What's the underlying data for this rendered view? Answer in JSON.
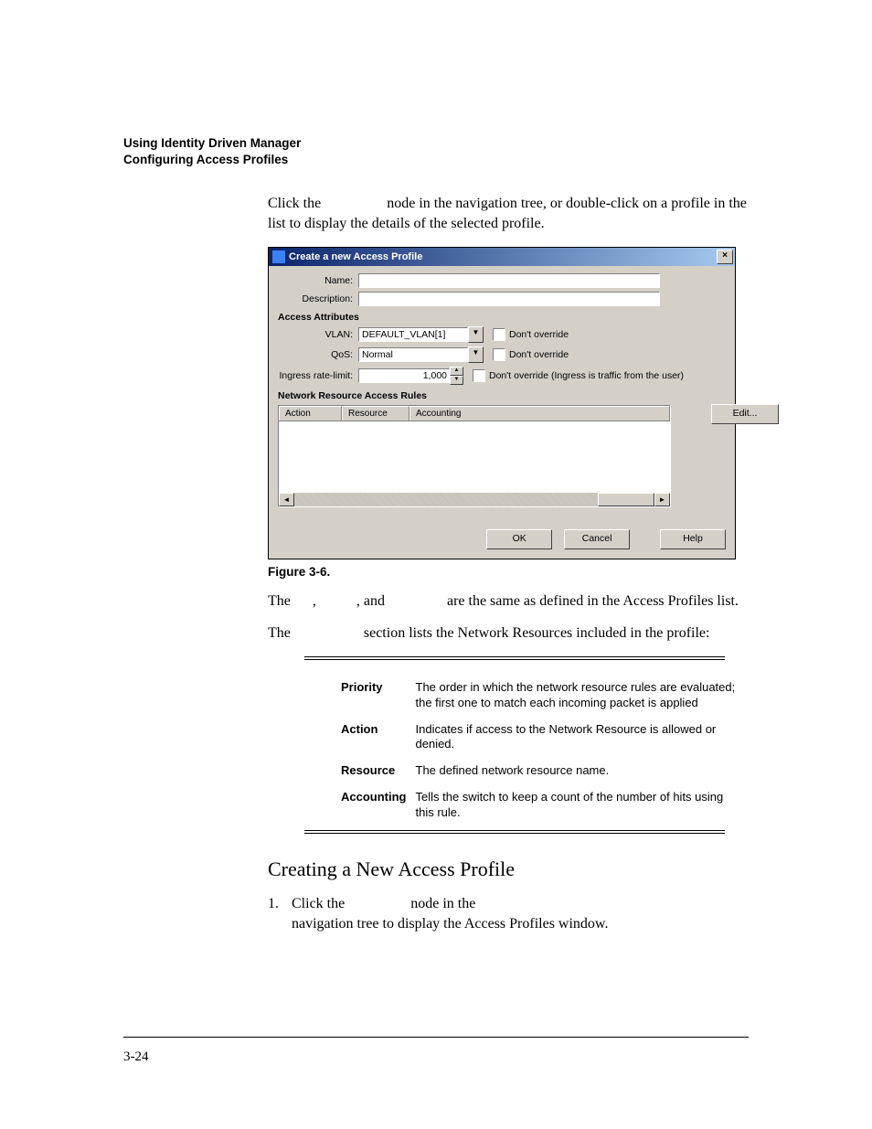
{
  "header": {
    "line1": "Using Identity Driven Manager",
    "line2": "Configuring Access Profiles"
  },
  "intro": {
    "p1": "Click the                  node in the navigation tree, or double-click on a profile in the list to display the details of the selected profile."
  },
  "dialog": {
    "title": "Create a new Access Profile",
    "name_label": "Name:",
    "name_value": "",
    "desc_label": "Description:",
    "desc_value": "",
    "group_attrs": "Access Attributes",
    "vlan_label": "VLAN:",
    "vlan_value": "DEFAULT_VLAN[1]",
    "qos_label": "QoS:",
    "qos_value": "Normal",
    "rate_label": "Ingress rate-limit:",
    "rate_value": "1,000",
    "dont_override": "Don't override",
    "rate_hint": "Don't override  (Ingress is traffic from the user)",
    "group_rules": "Network Resource Access Rules",
    "col_action": "Action",
    "col_resource": "Resource",
    "col_accounting": "Accounting",
    "btn_edit": "Edit...",
    "btn_ok": "OK",
    "btn_cancel": "Cancel",
    "btn_help": "Help"
  },
  "figcap": "Figure 3-6.",
  "after": {
    "p2": "The      ,           , and                 are the same as defined in the Access Profiles list.",
    "p3": "The                    section lists the Network Resources included in the profile:"
  },
  "table": [
    {
      "term": "Priority",
      "def": "The order in which the network resource rules are evaluated; the first one to match each incoming packet is applied"
    },
    {
      "term": "Action",
      "def": "Indicates if access to the Network Resource is allowed or denied."
    },
    {
      "term": "Resource",
      "def": "The defined network resource name."
    },
    {
      "term": "Accounting",
      "def": "Tells the switch to keep a count of the number of hits using this rule."
    }
  ],
  "heading": "Creating a New Access Profile",
  "list": {
    "item1_a": "Click the ",
    "item1_b": " node in the ",
    "item1_c": "navigation tree to display the Access Profiles window."
  },
  "pagenum": "3-24"
}
